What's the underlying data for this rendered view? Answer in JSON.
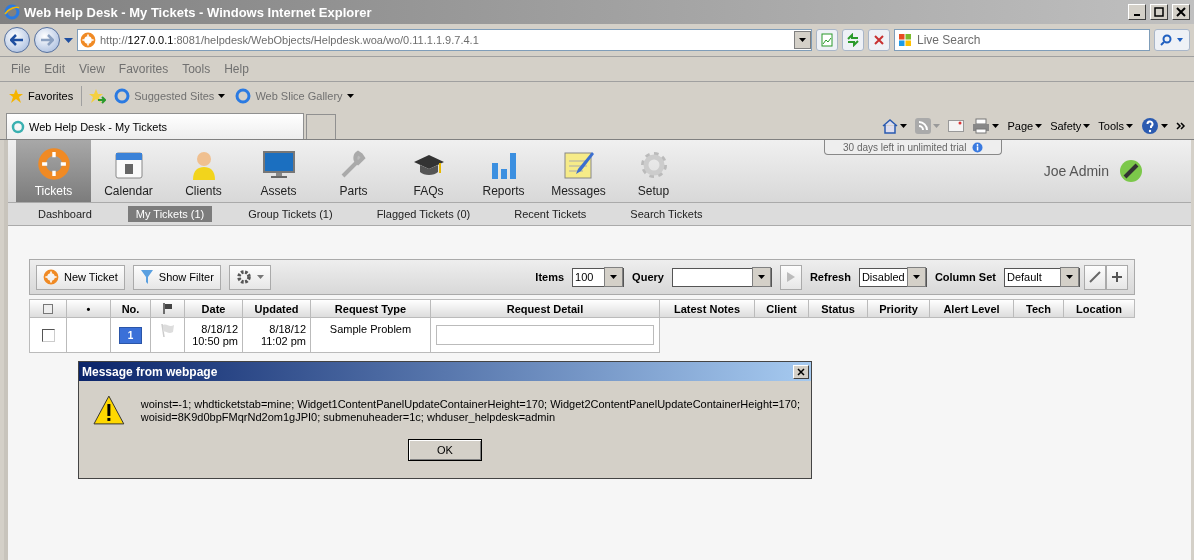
{
  "window": {
    "title": "Web Help Desk - My Tickets - Windows Internet Explorer"
  },
  "address_bar": {
    "url": "http://**127.0.0.1**:8081/helpdesk/WebObjects/Helpdesk.woa/wo/0.11.1.1.9.7.4.1"
  },
  "search": {
    "placeholder": "Live Search"
  },
  "menu": [
    "File",
    "Edit",
    "View",
    "Favorites",
    "Tools",
    "Help"
  ],
  "favorites_bar": {
    "label": "Favorites",
    "links": [
      "Suggested Sites",
      "Web Slice Gallery"
    ]
  },
  "browser_tab": {
    "title": "Web Help Desk - My Tickets"
  },
  "command_bar": [
    "Page",
    "Safety",
    "Tools"
  ],
  "app": {
    "nav": [
      {
        "label": "Tickets",
        "selected": true
      },
      {
        "label": "Calendar",
        "selected": false
      },
      {
        "label": "Clients",
        "selected": false
      },
      {
        "label": "Assets",
        "selected": false
      },
      {
        "label": "Parts",
        "selected": false
      },
      {
        "label": "FAQs",
        "selected": false
      },
      {
        "label": "Reports",
        "selected": false
      },
      {
        "label": "Messages",
        "selected": false
      },
      {
        "label": "Setup",
        "selected": false
      }
    ],
    "trial_notice": "30 days left in unlimited trial",
    "user": "Joe Admin",
    "subnav": [
      {
        "label": "Dashboard",
        "selected": false
      },
      {
        "label": "My Tickets (1)",
        "selected": true
      },
      {
        "label": "Group Tickets (1)",
        "selected": false
      },
      {
        "label": "Flagged Tickets (0)",
        "selected": false
      },
      {
        "label": "Recent Tickets",
        "selected": false
      },
      {
        "label": "Search Tickets",
        "selected": false
      }
    ],
    "toolbar": {
      "new_ticket": "New Ticket",
      "show_filter": "Show Filter",
      "items_label": "Items",
      "items_value": "100",
      "query_label": "Query",
      "refresh_label": "Refresh",
      "refresh_value": "Disabled",
      "column_set_label": "Column Set",
      "column_set_value": "Default"
    },
    "table": {
      "columns": [
        "•",
        "No.",
        "Date",
        "Updated",
        "Request Type",
        "Request Detail",
        "Latest Notes",
        "Client",
        "Status",
        "Priority",
        "Alert Level",
        "Tech",
        "Location"
      ],
      "rows": [
        {
          "checked": false,
          "number": "1",
          "date": "8/18/12 10:50 pm",
          "updated": "8/18/12 11:02 pm",
          "request_type": "Sample Problem"
        }
      ]
    }
  },
  "dialog": {
    "title": "Message from webpage",
    "message": "woinst=-1; whdticketstab=mine; Widget1ContentPanelUpdateContainerHeight=170; Widget2ContentPanelUpdateContainerHeight=170; woisid=8K9d0bpFMqrNd2om1gJPI0; submenuheader=1c; whduser_helpdesk=admin",
    "button": "OK"
  }
}
